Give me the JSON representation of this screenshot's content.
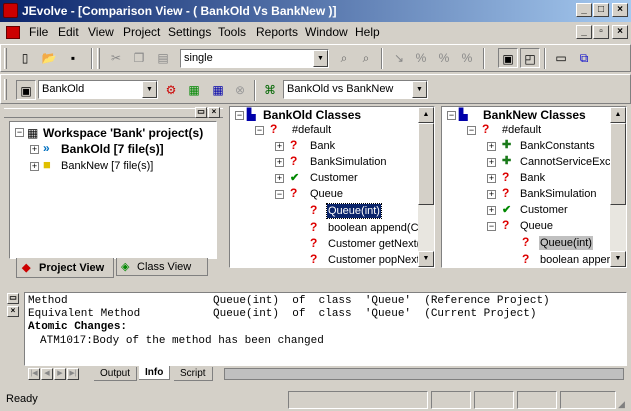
{
  "window": {
    "title": "JEvolve - [Comparison View - ( BankOld  Vs  BankNew )]"
  },
  "menu": [
    "File",
    "Edit",
    "View",
    "Project",
    "Settings",
    "Tools",
    "Reports",
    "Window",
    "Help"
  ],
  "toolbar": {
    "find_combo_value": "single"
  },
  "toolbar2": {
    "project_combo": "BankOld",
    "comparison_combo": "BankOld vs BankNew"
  },
  "project_panel": {
    "workspace": "Workspace 'Bank' project(s)",
    "projects": [
      "BankOld [7 file(s)]",
      "BankNew [7 file(s)]"
    ],
    "tabs": [
      "Project View",
      "Class View"
    ]
  },
  "old_classes": {
    "title": "BankOld Classes",
    "pkg": "#default",
    "items": [
      "Bank",
      "BankSimulation",
      "Customer",
      "Queue"
    ],
    "queue_members": [
      "Queue(int)",
      "boolean append(Cu",
      "Customer getNext()",
      "Customer popNext("
    ]
  },
  "new_classes": {
    "title": "BankNew Classes",
    "pkg": "#default",
    "items": [
      "BankConstants",
      "CannotServiceExc",
      "Bank",
      "BankSimulation",
      "Customer",
      "Queue"
    ],
    "queue_members": [
      "Queue(int)",
      "boolean apper"
    ]
  },
  "info": {
    "row1": {
      "label": "Method",
      "value": "Queue(int)  of  class  'Queue'  (Reference Project)"
    },
    "row2": {
      "label": "Equivalent Method",
      "value": "Queue(int)  of  class  'Queue'  (Current Project)"
    },
    "heading": "Atomic Changes:",
    "change": "ATM1017:Body of the method has been changed",
    "tabs": [
      "Output",
      "Info",
      "Script"
    ]
  },
  "status": {
    "text": "Ready"
  },
  "colors": {
    "title_start": "#0a246a",
    "title_end": "#a6caf0",
    "selection": "#0a246a"
  }
}
